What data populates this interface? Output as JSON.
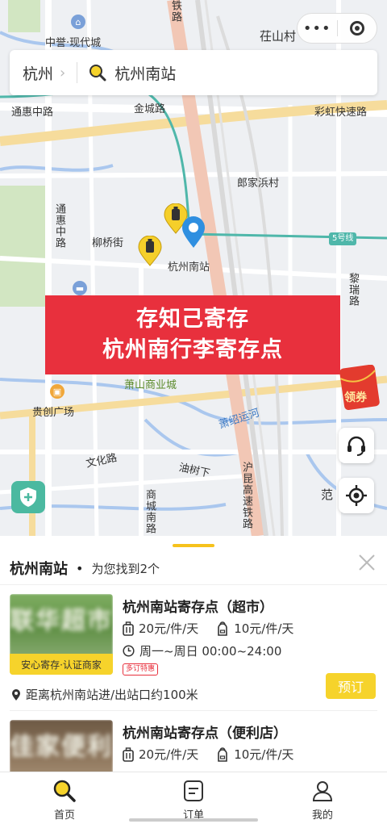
{
  "map": {
    "labels": {
      "zhongyu": "中誉·现代城",
      "zhuangshancun": "茌山村",
      "tonghuizhonglu": "通惠中路",
      "jincheng": "金城路",
      "caihong": "彩虹快速路",
      "langjiabang": "郎家浜村",
      "tonghui_v": "通惠中路",
      "liuqiao": "柳桥街",
      "station": "杭州南站",
      "line5": "5号线",
      "lilong": "黎瑞路",
      "tielu": "铁路",
      "xiaoshan": "萧山商业城",
      "guichuang": "贵创广场",
      "xiaoshao": "萧绍运河",
      "wenhua": "文化路",
      "youshu": "油树下",
      "hukun": "沪昆高速铁路",
      "shangcheng": "商城南路",
      "fan": "范"
    },
    "coupon_label": "领券"
  },
  "capsule": {
    "dots": "•••"
  },
  "search": {
    "city": "杭州",
    "query": "杭州南站"
  },
  "banner": {
    "line1": "存知己寄存",
    "line2": "杭州南行李寄存点"
  },
  "sheet": {
    "station": "杭州南站",
    "separator": "•",
    "found": "为您找到2个",
    "cards": [
      {
        "title": "杭州南站寄存点（超市）",
        "price_luggage": "20元/件/天",
        "price_bag": "10元/件/天",
        "hours": "周一~周日 00:00~24:00",
        "promo": "多订特惠",
        "badge": "安心寄存·认证商家",
        "thumb_text": "联华超市",
        "distance": "距离杭州南站进/出站口约100米",
        "book": "预订"
      },
      {
        "title": "杭州南站寄存点（便利店）",
        "price_luggage": "20元/件/天",
        "price_bag": "10元/件/天",
        "thumb_text": "佳家便利"
      }
    ]
  },
  "tabs": [
    {
      "label": "首页",
      "icon": "search-icon"
    },
    {
      "label": "订单",
      "icon": "order-icon"
    },
    {
      "label": "我的",
      "icon": "user-icon"
    }
  ],
  "colors": {
    "accent": "#f6d32b",
    "banner": "#e8303d",
    "pin": "#2f8fe0"
  }
}
